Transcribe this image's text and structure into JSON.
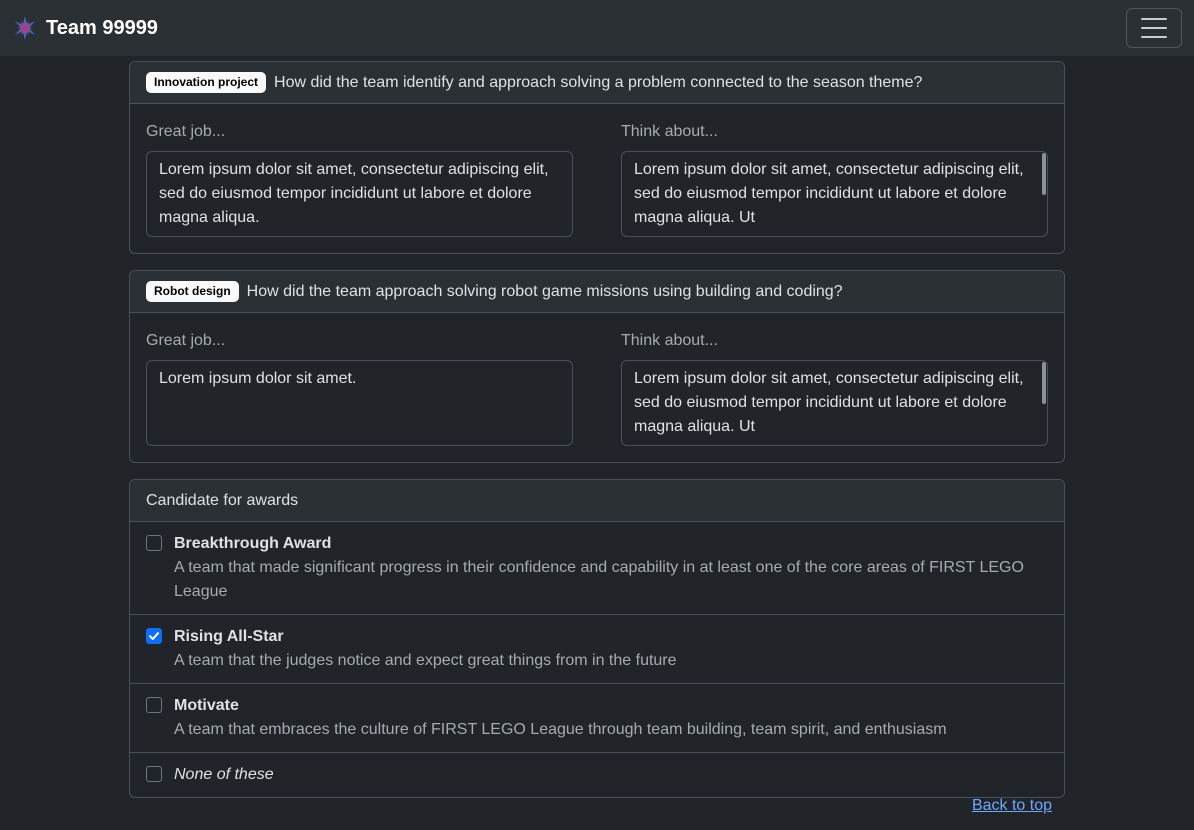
{
  "navbar": {
    "title": "Team 99999",
    "logo_icon": "star-burst-icon",
    "menu_icon": "hamburger-menu-icon"
  },
  "sections": [
    {
      "badge": "Innovation project",
      "question": "How did the team identify and approach solving a problem connected to the season theme?",
      "great_label": "Great job...",
      "great_value": "Lorem ipsum dolor sit amet, consectetur adipiscing elit, sed do eiusmod tempor incididunt ut labore et dolore magna aliqua.",
      "think_label": "Think about...",
      "think_value": "Lorem ipsum dolor sit amet, consectetur adipiscing elit, sed do eiusmod tempor incididunt ut labore et dolore magna aliqua. Ut"
    },
    {
      "badge": "Robot design",
      "question": "How did the team approach solving robot game missions using building and coding?",
      "great_label": "Great job...",
      "great_value": "Lorem ipsum dolor sit amet.",
      "think_label": "Think about...",
      "think_value": "Lorem ipsum dolor sit amet, consectetur adipiscing elit, sed do eiusmod tempor incididunt ut labore et dolore magna aliqua. Ut"
    }
  ],
  "awards": {
    "header": "Candidate for awards",
    "items": [
      {
        "title": "Breakthrough Award",
        "desc": "A team that made significant progress in their confidence and capability in at least one of the core areas of FIRST LEGO League",
        "checked": false
      },
      {
        "title": "Rising All-Star",
        "desc": "A team that the judges notice and expect great things from in the future",
        "checked": true
      },
      {
        "title": "Motivate",
        "desc": "A team that embraces the culture of FIRST LEGO League through team building, team spirit, and enthusiasm",
        "checked": false
      }
    ],
    "none_label": "None of these"
  },
  "back_to_top": "Back to top",
  "colors": {
    "accent": "#0d6efd",
    "link": "#6ea8fe",
    "background": "#212529"
  }
}
